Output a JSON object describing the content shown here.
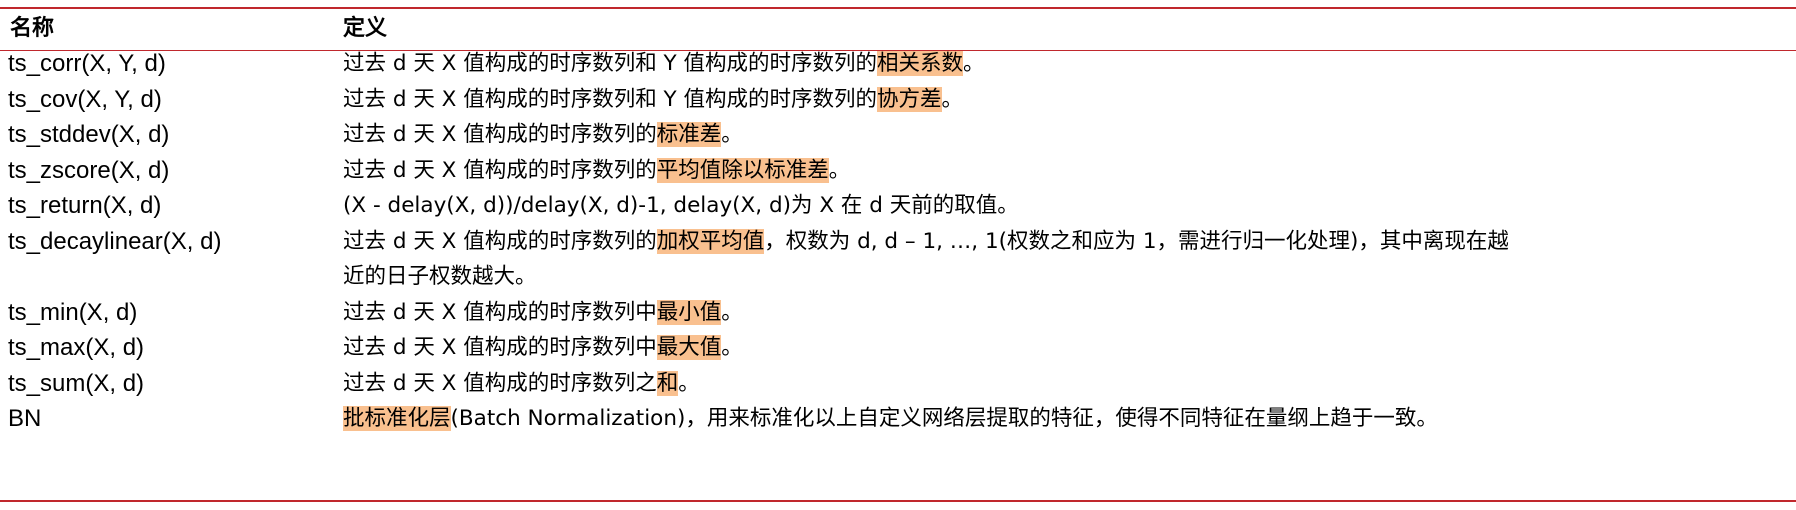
{
  "header": {
    "name_col": "名称",
    "def_col": "定义"
  },
  "colors": {
    "rule": "#c0282d",
    "highlight": "#f9c08f"
  },
  "rows": [
    {
      "name": "ts_corr(X, Y, d)",
      "lines": [
        [
          {
            "t": "过去 d 天 X 值构成的时序数列和 Y 值构成的时序数列的"
          },
          {
            "t": "相关系数",
            "hl": true
          },
          {
            "t": "。"
          }
        ]
      ]
    },
    {
      "name": "ts_cov(X, Y, d)",
      "lines": [
        [
          {
            "t": "过去 d 天 X 值构成的时序数列和 Y 值构成的时序数列的"
          },
          {
            "t": "协方差",
            "hl": true
          },
          {
            "t": "。"
          }
        ]
      ]
    },
    {
      "name": "ts_stddev(X, d)",
      "lines": [
        [
          {
            "t": "过去 d 天 X 值构成的时序数列的"
          },
          {
            "t": "标准差",
            "hl": true
          },
          {
            "t": "。"
          }
        ]
      ]
    },
    {
      "name": "ts_zscore(X, d)",
      "lines": [
        [
          {
            "t": "过去 d 天 X 值构成的时序数列的"
          },
          {
            "t": "平均值除以标准差",
            "hl": true
          },
          {
            "t": "。"
          }
        ]
      ]
    },
    {
      "name": "ts_return(X, d)",
      "lines": [
        [
          {
            "t": "(X - delay(X, d))/delay(X, d)-1, delay(X, d)为 X 在 d 天前的取值。"
          }
        ]
      ]
    },
    {
      "name": "ts_decaylinear(X, d)",
      "lines": [
        [
          {
            "t": "过去 d 天 X 值构成的时序数列的"
          },
          {
            "t": "加权平均值",
            "hl": true
          },
          {
            "t": "，权数为 d, d – 1, …, 1(权数之和应为 1，需进行归一化处理)，其中离现在越"
          }
        ],
        [
          {
            "t": "近的日子权数越大。"
          }
        ]
      ]
    },
    {
      "name": "ts_min(X, d)",
      "lines": [
        [
          {
            "t": "过去 d 天 X 值构成的时序数列中"
          },
          {
            "t": "最小值",
            "hl": true
          },
          {
            "t": "。"
          }
        ]
      ]
    },
    {
      "name": "ts_max(X, d)",
      "lines": [
        [
          {
            "t": "过去 d 天 X 值构成的时序数列中"
          },
          {
            "t": "最大值",
            "hl": true
          },
          {
            "t": "。"
          }
        ]
      ]
    },
    {
      "name": "ts_sum(X, d)",
      "lines": [
        [
          {
            "t": "过去 d 天 X 值构成的时序数列之"
          },
          {
            "t": "和",
            "hl": true
          },
          {
            "t": "。"
          }
        ]
      ]
    },
    {
      "name": "BN",
      "lines": [
        [
          {
            "t": "批标准化层",
            "hl": true
          },
          {
            "t": "(Batch Normalization)，用来标准化以上自定义网络层提取的特征，使得不同特征在量纲上趋于一致。"
          }
        ]
      ]
    }
  ]
}
